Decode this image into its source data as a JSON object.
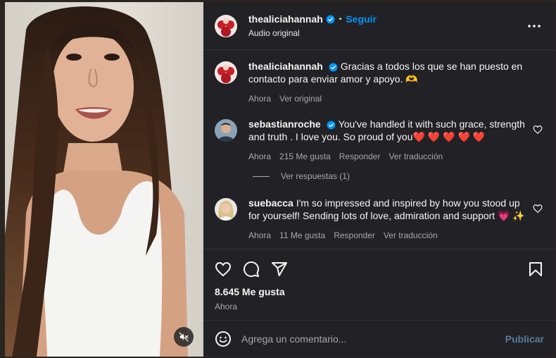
{
  "post": {
    "author": "thealiciahannah",
    "follow_label": "Seguir",
    "dot": "•",
    "audio": "Audio original",
    "caption": "Gracias a todos los que se han puesto en contacto para enviar amor y apoyo. 🫶",
    "caption_time": "Ahora",
    "caption_translate": "Ver original"
  },
  "comments": [
    {
      "user": "sebastianroche",
      "text": "You've handled it with such grace, strength and truth . I love you. So proud of you❤️ ❤️ ❤️ ❤️ ❤️",
      "time": "Ahora",
      "likes": "215 Me gusta",
      "reply": "Responder",
      "translate": "Ver traducción",
      "replies": "Ver respuestas (1)"
    },
    {
      "user": "suebacca",
      "text": "I'm so impressed and inspired by how you stood up for yourself! Sending lots of love, admiration and support 💗 ✨",
      "time": "Ahora",
      "likes": "11 Me gusta",
      "reply": "Responder",
      "translate": "Ver traducción"
    }
  ],
  "actions": {
    "likes_count": "8.645 Me gusta",
    "time": "Ahora"
  },
  "composer": {
    "placeholder": "Agrega un comentario...",
    "publish": "Publicar"
  },
  "icons": [
    "heart-icon",
    "comment-icon",
    "share-icon",
    "bookmark-icon",
    "more-icon",
    "mute-icon",
    "emoji-icon",
    "verified-icon"
  ],
  "colors": {
    "accent": "#0095f6",
    "panel": "#222226",
    "muted": "#a8a8a8",
    "heart": "#ff3040"
  }
}
